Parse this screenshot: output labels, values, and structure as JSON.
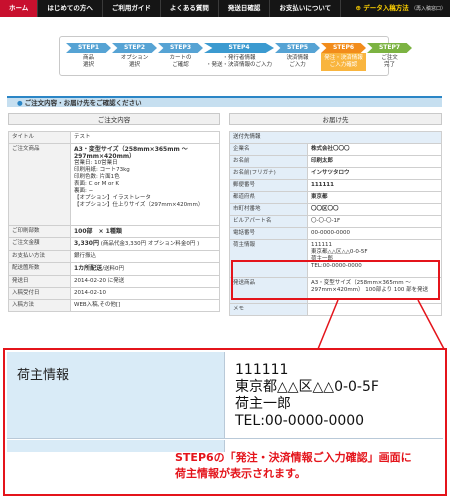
{
  "nav": {
    "items": [
      "ホーム",
      "はじめての方へ",
      "ご利用ガイド",
      "よくある質問",
      "発送日確認",
      "お支払いについて"
    ],
    "data_label": "データ入稿方法",
    "data_sub": "（再入稿窓口）"
  },
  "steps": [
    {
      "num": "STEP1",
      "l1": "商品",
      "l2": "選択"
    },
    {
      "num": "STEP2",
      "l1": "オプション",
      "l2": "選択"
    },
    {
      "num": "STEP3",
      "l1": "カートの",
      "l2": "ご確認"
    },
    {
      "num": "STEP4",
      "l1": "・発行者情報",
      "l2": "・発送・決済情報のご入力"
    },
    {
      "num": "STEP5",
      "l1": "決済情報",
      "l2": "ご入力"
    },
    {
      "num": "STEP6",
      "l1": "発注・決済情報",
      "l2": "ご入力確認"
    },
    {
      "num": "STEP7",
      "l1": "ご注文",
      "l2": "完了"
    }
  ],
  "section_title": "ご注文内容・お届け先をご確認ください",
  "order_header": "ご注文内容",
  "recipient_header": "お届け先",
  "order": {
    "title_k": "タイトル",
    "title_v": "テスト",
    "product_k": "ご注文商品",
    "product_name": "A3・変型サイズ（258mm×365mm 〜 297mm×420mm）",
    "product_lines": [
      "営業日: 10営業日",
      "印刷用紙: コート73kg",
      "印刷色数: 片面1色",
      "表面: C or M or K",
      "裏面: −",
      "【オプション】イラストレータ",
      "【オプション】仕上りサイズ（297mm×420mm）"
    ],
    "qty_k": "ご印刷部数",
    "qty_v": "100部　× 1種類",
    "amount_k": "ご注文金額",
    "amount_v": "3,330円",
    "amount_note": "(商品代金3,330円 オプション料金0円 )",
    "pay_k": "お支払い方法",
    "pay_v": "銀行振込",
    "ship_k": "配送箇所数",
    "ship_v": "1カ所配送",
    "ship_note": "/送料0円",
    "date_k": "発送日",
    "date_v": "2014-02-20 に発送",
    "recv_k": "入稿受付日",
    "recv_v": "2014-02-10",
    "method_k": "入稿方法",
    "method_v": "WEB入稿,その他[]"
  },
  "recipient": {
    "section": "送付先情報",
    "company_k": "企業名",
    "company_v": "株式会社〇〇〇",
    "name_k": "お名前",
    "name_v": "印刷太郎",
    "kana_k": "お名前(フリガナ)",
    "kana_v": "インサツタロウ",
    "zip_k": "郵便番号",
    "zip_v": "111111",
    "pref_k": "都道府県",
    "pref_v": "東京都",
    "city_k": "市町村番地",
    "city_v": "〇〇区〇〇",
    "bldg_k": "ビルアパート名",
    "bldg_v": "〇-〇-〇-1F",
    "tel_k": "電話番号",
    "tel_v": "00-0000-0000",
    "shipper_k": "荷主情報",
    "shipper_lines": [
      "111111",
      "東京都△△区△△0-0-5F",
      "荷主一郎",
      "TEL:00-0000-0000"
    ],
    "goods_k": "発送商品",
    "goods_v": "A3・変型サイズ（258mm×365mm 〜 297mm×420mm） 100部より 100 部を発送",
    "memo_k": "メモ",
    "memo_v": ""
  },
  "zoom": {
    "label": "荷主情報",
    "lines": [
      "111111",
      "東京都△△区△△0-0-5F",
      "荷主一郎",
      "TEL:00-0000-0000"
    ]
  },
  "caption": {
    "line1": "STEP6の「発注・決済情報ご入力確認」画面に",
    "line2": "荷主情報が表示されます。"
  },
  "colors": {
    "accent_red": "#e4141b",
    "step_blue": "#2b86c6",
    "step_orange": "#f28c1b",
    "step_green": "#7cb342",
    "nav_bg": "#151515",
    "nav_active": "#c8102e"
  }
}
